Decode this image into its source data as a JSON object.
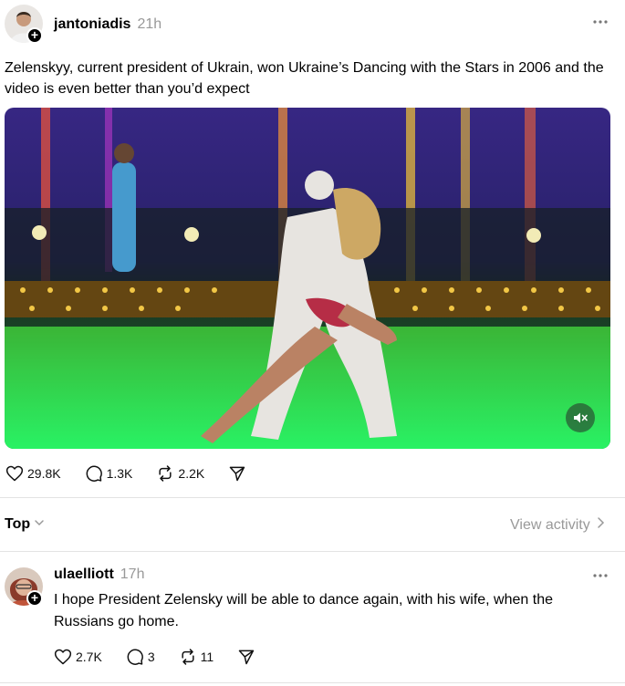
{
  "post": {
    "author": "jantoniadis",
    "time": "21h",
    "text": "Zelenskyy, current president of Ukrain, won Ukraine’s Dancing with the Stars in 2006 and the video is even better than you’d expect",
    "actions": {
      "likes": "29.8K",
      "comments": "1.3K",
      "reposts": "2.2K"
    }
  },
  "sort": {
    "label": "Top",
    "view_activity": "View activity"
  },
  "reply": {
    "author": "ulaelliott",
    "time": "17h",
    "text": "I hope President Zelensky will be able to dance again, with his wife, when the Russians go home.",
    "actions": {
      "likes": "2.7K",
      "comments": "3",
      "reposts": "11"
    }
  },
  "icons": {
    "more": "more-options-icon",
    "like": "heart-icon",
    "comment": "comment-icon",
    "repost": "repost-icon",
    "share": "send-icon",
    "mute": "muted-speaker-icon",
    "follow": "plus-icon",
    "chevron": "chevron-down-icon"
  }
}
